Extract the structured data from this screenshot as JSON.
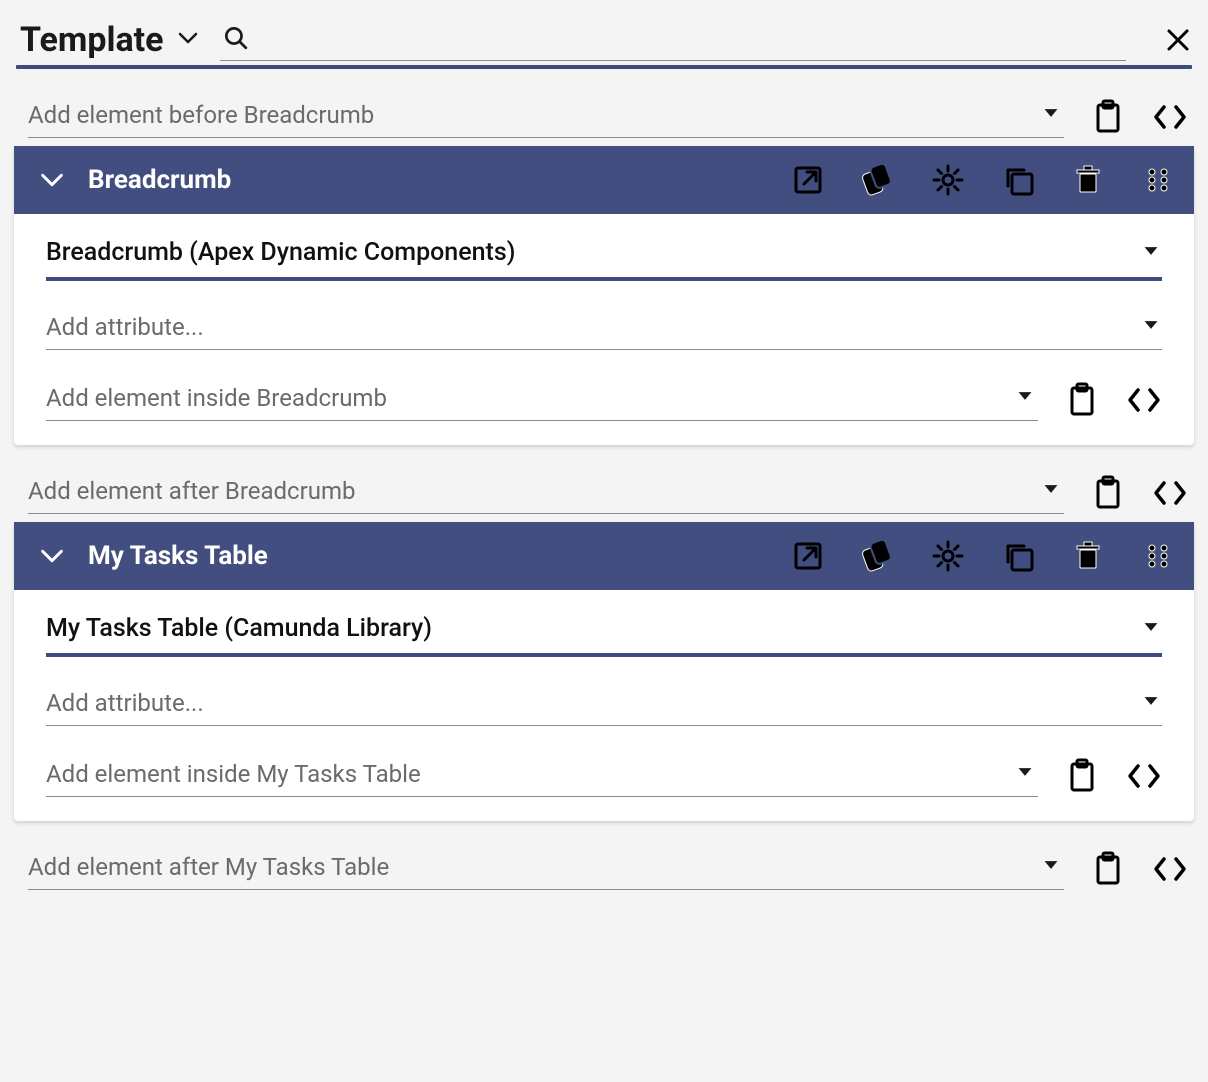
{
  "header": {
    "title": "Template"
  },
  "rows": {
    "add_before_breadcrumb": "Add element before Breadcrumb",
    "add_after_breadcrumb": "Add element after Breadcrumb",
    "add_after_mytasks": "Add element after My Tasks Table"
  },
  "components": [
    {
      "name": "Breadcrumb",
      "type_label": "Breadcrumb (Apex Dynamic Components)",
      "attr_placeholder": "Add attribute...",
      "add_inside": "Add element inside Breadcrumb"
    },
    {
      "name": "My Tasks Table",
      "type_label": "My Tasks Table (Camunda Library)",
      "attr_placeholder": "Add attribute...",
      "add_inside": "Add element inside My Tasks Table"
    }
  ],
  "colors": {
    "header_bg": "#424e7f",
    "accent": "#3f4b7d"
  }
}
